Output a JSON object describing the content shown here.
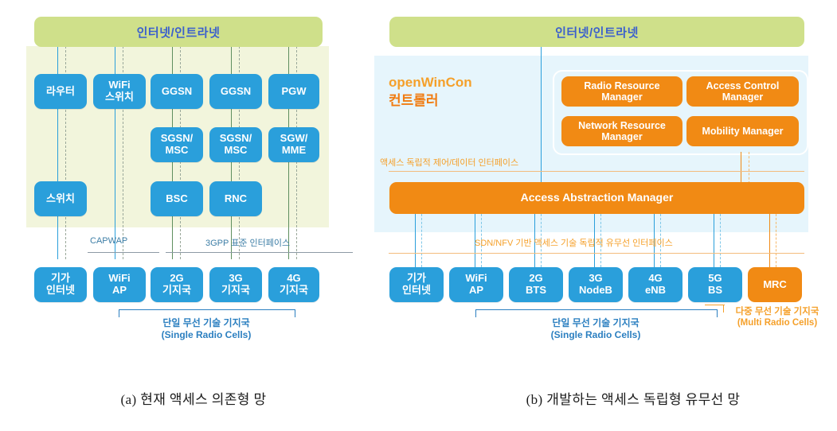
{
  "figure": {
    "caption_a": "(a) 현재 액세스 의존형 망",
    "caption_b": "(b) 개발하는 액세스 독립형 유무선 망"
  },
  "colors": {
    "blue_box": "#2a9fdb",
    "orange_box": "#f18a14",
    "internet_bar": "#cfe08a",
    "left_panel_bg": "#f2f5dc",
    "right_panel_bg": "#e6f5fc",
    "internet_text": "#3a5fcd",
    "label_blue": "#2b7fc0",
    "label_orange": "#f5a02a"
  },
  "left": {
    "internet_bar": "인터넷/인트라넷",
    "core_boxes": [
      {
        "label": "라우터"
      },
      {
        "label": "WiFi\n스위치"
      },
      {
        "label": "GGSN"
      },
      {
        "label": "GGSN"
      },
      {
        "label": "PGW"
      },
      {
        "label": "SGSN/\nMSC"
      },
      {
        "label": "SGSN/\nMSC"
      },
      {
        "label": "SGW/\nMME"
      },
      {
        "label": "스위치"
      },
      {
        "label": "BSC"
      },
      {
        "label": "RNC"
      }
    ],
    "box_router": "라우터",
    "box_wifi_switch_l1": "WiFi",
    "box_wifi_switch_l2": "스위치",
    "box_ggsn_1": "GGSN",
    "box_ggsn_2": "GGSN",
    "box_pgw": "PGW",
    "box_sgsn_msc_1_l1": "SGSN/",
    "box_sgsn_msc_1_l2": "MSC",
    "box_sgsn_msc_2_l1": "SGSN/",
    "box_sgsn_msc_2_l2": "MSC",
    "box_sgw_mme_l1": "SGW/",
    "box_sgw_mme_l2": "MME",
    "box_switch": "스위치",
    "box_bsc": "BSC",
    "box_rnc": "RNC",
    "interface_capwap": "CAPWAP",
    "interface_3gpp": "3GPP 표준 인터페이스",
    "access_boxes": [
      {
        "l1": "기가",
        "l2": "인터넷"
      },
      {
        "l1": "WiFi",
        "l2": "AP"
      },
      {
        "l1": "2G",
        "l2": "기지국"
      },
      {
        "l1": "3G",
        "l2": "기지국"
      },
      {
        "l1": "4G",
        "l2": "기지국"
      }
    ],
    "acc_giga_l1": "기가",
    "acc_giga_l2": "인터넷",
    "acc_wifi_l1": "WiFi",
    "acc_wifi_l2": "AP",
    "acc_2g_l1": "2G",
    "acc_2g_l2": "기지국",
    "acc_3g_l1": "3G",
    "acc_3g_l2": "기지국",
    "acc_4g_l1": "4G",
    "acc_4g_l2": "기지국",
    "bracket_ko": "단일 무선 기술 기지국",
    "bracket_en": "(Single Radio Cells)"
  },
  "right": {
    "internet_bar": "인터넷/인트라넷",
    "controller_name_en": "openWinCon",
    "controller_name_ko": "컨트롤러",
    "managers": [
      {
        "l1": "Radio Resource",
        "l2": "Manager"
      },
      {
        "l1": "Access Control",
        "l2": "Manager"
      },
      {
        "l1": "Network Resource",
        "l2": "Manager"
      },
      {
        "l1": "Mobility Manager",
        "l2": ""
      }
    ],
    "mgr_rrm_l1": "Radio Resource",
    "mgr_rrm_l2": "Manager",
    "mgr_acm_l1": "Access Control",
    "mgr_acm_l2": "Manager",
    "mgr_nrm_l1": "Network Resource",
    "mgr_nrm_l2": "Manager",
    "mgr_mm": "Mobility Manager",
    "interface_ctrl_data": "액세스 독립적 제어/데이터 인터페이스",
    "aam": "Access Abstraction Manager",
    "interface_sdn_nfv": "SDN/NFV 기반 액세스 기술 독립적 유무선 인터페이스",
    "access_boxes": [
      {
        "l1": "기가",
        "l2": "인터넷"
      },
      {
        "l1": "WiFi",
        "l2": "AP"
      },
      {
        "l1": "2G",
        "l2": "BTS"
      },
      {
        "l1": "3G",
        "l2": "NodeB"
      },
      {
        "l1": "4G",
        "l2": "eNB"
      },
      {
        "l1": "5G",
        "l2": "BS"
      }
    ],
    "acc_giga_l1": "기가",
    "acc_giga_l2": "인터넷",
    "acc_wifi_l1": "WiFi",
    "acc_wifi_l2": "AP",
    "acc_2g_l1": "2G",
    "acc_2g_l2": "BTS",
    "acc_3g_l1": "3G",
    "acc_3g_l2": "NodeB",
    "acc_4g_l1": "4G",
    "acc_4g_l2": "eNB",
    "acc_5g_l1": "5G",
    "acc_5g_l2": "BS",
    "acc_mrc": "MRC",
    "bracket_ko": "단일 무선 기술 기지국",
    "bracket_en": "(Single Radio Cells)",
    "mrc_bracket_ko": "다중 무선 기술 기지국",
    "mrc_bracket_en": "(Multi Radio Cells)"
  }
}
